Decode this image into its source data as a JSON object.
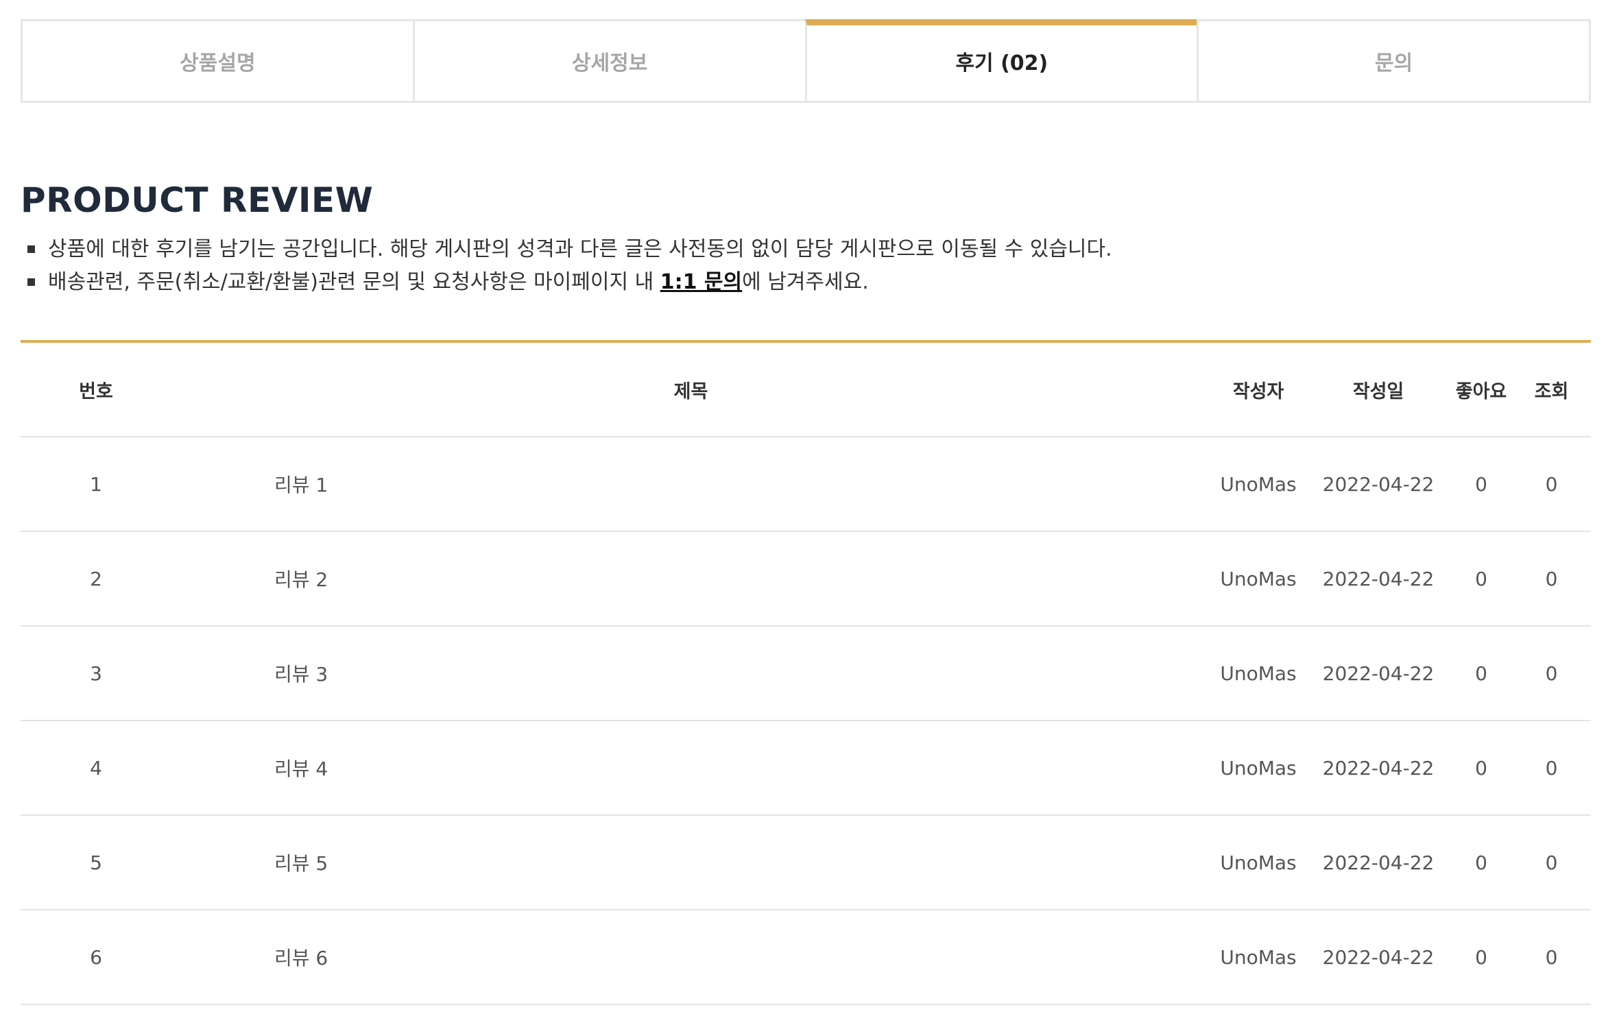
{
  "tabs": [
    {
      "label": "상품설명",
      "active": false
    },
    {
      "label": "상세정보",
      "active": false
    },
    {
      "label": "후기 (02)",
      "active": true
    },
    {
      "label": "문의",
      "active": false
    }
  ],
  "section": {
    "title": "PRODUCT REVIEW",
    "notes": {
      "line1": "상품에 대한 후기를 남기는 공간입니다. 해당 게시판의 성격과 다른 글은 사전동의 없이 담당 게시판으로 이동될 수 있습니다.",
      "line2_before": "배송관련, 주문(취소/교환/환불)관련 문의 및 요청사항은 마이페이지 내 ",
      "line2_link": "1:1 문의",
      "line2_after": "에 남겨주세요."
    }
  },
  "table": {
    "headers": {
      "num": "번호",
      "subject": "제목",
      "writer": "작성자",
      "date": "작성일",
      "likes": "좋아요",
      "views": "조회"
    },
    "rows": [
      {
        "num": "1",
        "subject": "리뷰 1",
        "writer": "UnoMas",
        "date": "2022-04-22",
        "likes": "0",
        "views": "0"
      },
      {
        "num": "2",
        "subject": "리뷰 2",
        "writer": "UnoMas",
        "date": "2022-04-22",
        "likes": "0",
        "views": "0"
      },
      {
        "num": "3",
        "subject": "리뷰 3",
        "writer": "UnoMas",
        "date": "2022-04-22",
        "likes": "0",
        "views": "0"
      },
      {
        "num": "4",
        "subject": "리뷰 4",
        "writer": "UnoMas",
        "date": "2022-04-22",
        "likes": "0",
        "views": "0"
      },
      {
        "num": "5",
        "subject": "리뷰 5",
        "writer": "UnoMas",
        "date": "2022-04-22",
        "likes": "0",
        "views": "0"
      },
      {
        "num": "6",
        "subject": "리뷰 6",
        "writer": "UnoMas",
        "date": "2022-04-22",
        "likes": "0",
        "views": "0"
      }
    ]
  },
  "colors": {
    "accent": "#dfac54",
    "heading": "#1f2a3a",
    "tab_inactive": "#a6a6a6",
    "border": "#e4e4e4"
  }
}
